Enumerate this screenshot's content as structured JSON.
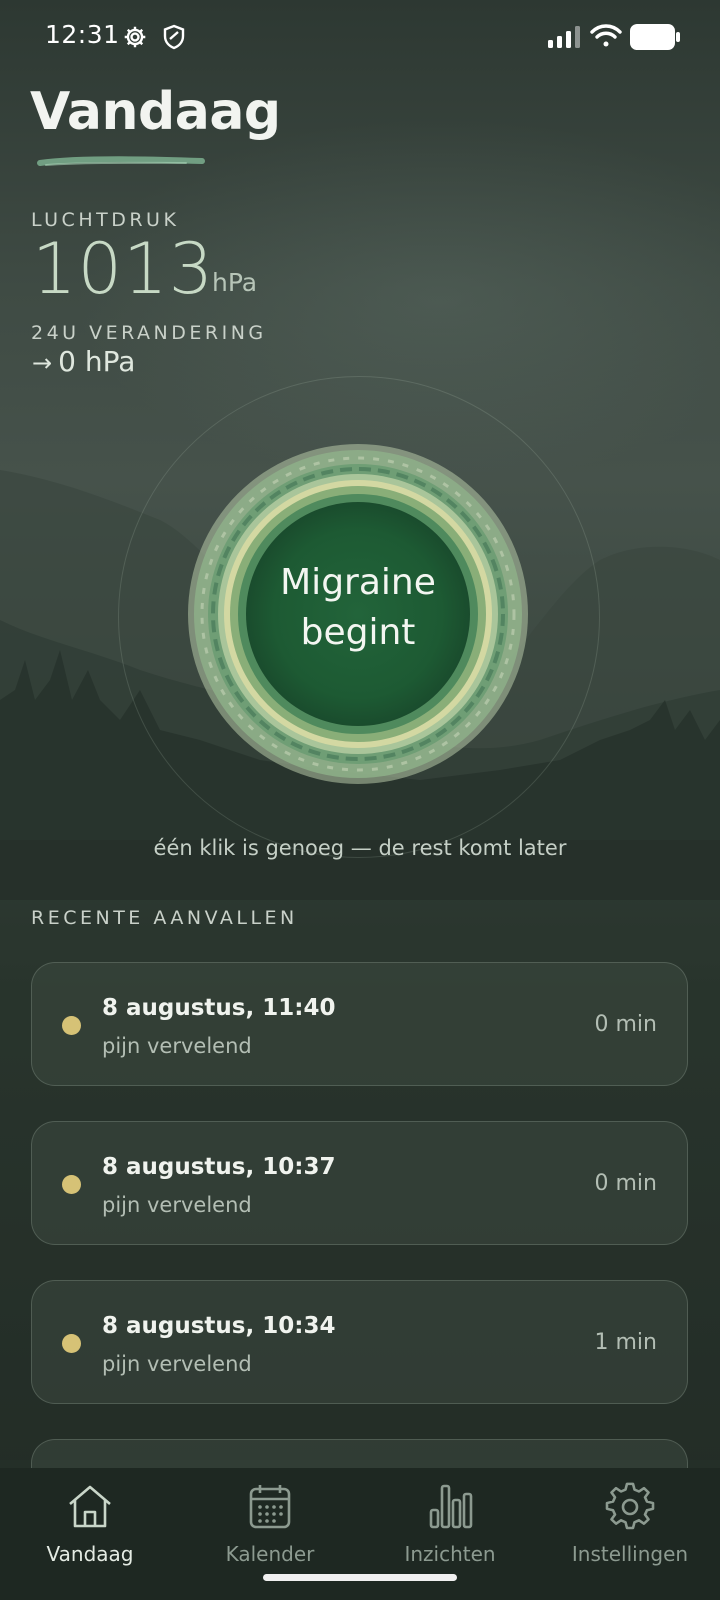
{
  "status_bar": {
    "time": "12:31",
    "icons": [
      "settings-icon",
      "shield-icon",
      "signal-icon",
      "wifi-icon",
      "battery-icon"
    ]
  },
  "header": {
    "title": "Vandaag"
  },
  "pressure": {
    "label": "LUCHTDRUK",
    "value": "1013",
    "unit": "hPa",
    "change_label": "24U VERANDERING",
    "change_arrow": "→",
    "change_value": "0 hPa"
  },
  "migraine_button": {
    "label_line1": "Migraine",
    "label_line2": "begint",
    "hint": "één klik is genoeg — de rest komt later"
  },
  "recent": {
    "title": "RECENTE AANVALLEN",
    "items": [
      {
        "date": "8 augustus, 11:40",
        "description": "pijn vervelend",
        "duration": "0 min"
      },
      {
        "date": "8 augustus, 10:37",
        "description": "pijn vervelend",
        "duration": "0 min"
      },
      {
        "date": "8 augustus, 10:34",
        "description": "pijn vervelend",
        "duration": "1 min"
      }
    ]
  },
  "nav": {
    "items": [
      {
        "label": "Vandaag",
        "icon": "home-icon",
        "active": true
      },
      {
        "label": "Kalender",
        "icon": "calendar-icon",
        "active": false
      },
      {
        "label": "Inzichten",
        "icon": "bar-chart-icon",
        "active": false
      },
      {
        "label": "Instellingen",
        "icon": "gear-icon",
        "active": false
      }
    ]
  },
  "colors": {
    "accent_green": "#1f5a34",
    "dot_yellow": "#d6c276",
    "nav_background": "#1e2822"
  }
}
